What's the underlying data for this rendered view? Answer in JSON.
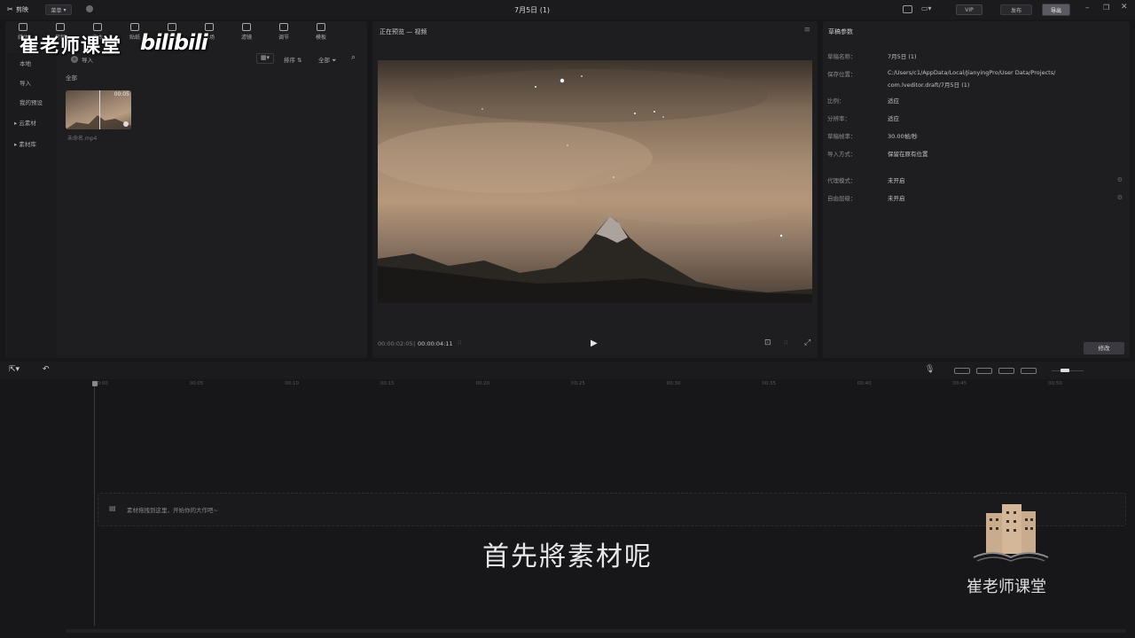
{
  "titlebar": {
    "app_name": "剪映",
    "menu_label": "菜单",
    "project_title": "7月5日 (1)",
    "vip_label": "VIP",
    "publish_label": "发布",
    "export_label": "导出"
  },
  "toolbar": {
    "tools": [
      {
        "label": "媒体",
        "icon": "media-icon"
      },
      {
        "label": "音频",
        "icon": "audio-icon"
      },
      {
        "label": "文本",
        "icon": "text-icon"
      },
      {
        "label": "贴纸",
        "icon": "sticker-icon"
      },
      {
        "label": "特效",
        "icon": "effects-icon"
      },
      {
        "label": "转场",
        "icon": "transition-icon"
      },
      {
        "label": "滤镜",
        "icon": "filter-icon"
      },
      {
        "label": "调节",
        "icon": "adjust-icon"
      },
      {
        "label": "模板",
        "icon": "template-icon"
      }
    ]
  },
  "watermark": {
    "top_text": "崔老师课堂",
    "bilibili": "bilibili",
    "bottom_text": "崔老师课堂"
  },
  "media_sidebar": {
    "items": [
      "本地",
      "导入",
      "我的预设",
      "云素材",
      "素材库"
    ]
  },
  "media_panel": {
    "import_label": "导入",
    "view_label": "排序",
    "filter_label": "全部",
    "section_label": "全部",
    "clip": {
      "duration": "00:05",
      "name": "未命名.mp4"
    }
  },
  "preview": {
    "header": "正在预览 — 视频",
    "current_time": "00:00:02:05",
    "total_time": "00:00:04:11"
  },
  "draft": {
    "header": "草稿参数",
    "fields": [
      {
        "label": "草稿名称：",
        "value": "7月5日 (1)"
      },
      {
        "label": "保存位置：",
        "value": "C:/Users/c1/AppData/Local/JianyingPro/User Data/Projects/"
      },
      {
        "label": "",
        "value": "com.lveditor.draft/7月5日 (1)"
      },
      {
        "label": "比例：",
        "value": "适应"
      },
      {
        "label": "分辨率：",
        "value": "适应"
      },
      {
        "label": "草稿帧率：",
        "value": "30.00帧/秒"
      },
      {
        "label": "导入方式：",
        "value": "保留在原有位置"
      },
      {
        "label": "代理模式：",
        "value": "未开启"
      },
      {
        "label": "自由层级：",
        "value": "未开启"
      }
    ],
    "edit_button": "修改"
  },
  "timeline": {
    "ruler": [
      "00:00",
      "00:05",
      "00:10",
      "00:15",
      "00:20",
      "00:25",
      "00:30",
      "00:35",
      "00:40",
      "00:45",
      "00:50"
    ],
    "drop_hint": "素材拖拽到这里，开始你的大作吧~"
  },
  "subtitle": "首先將素材呢",
  "colors": {
    "bg": "#17171a",
    "panel": "#1e1e21",
    "export_btn": "#3e3e44",
    "accent": "#4fc3d8"
  }
}
